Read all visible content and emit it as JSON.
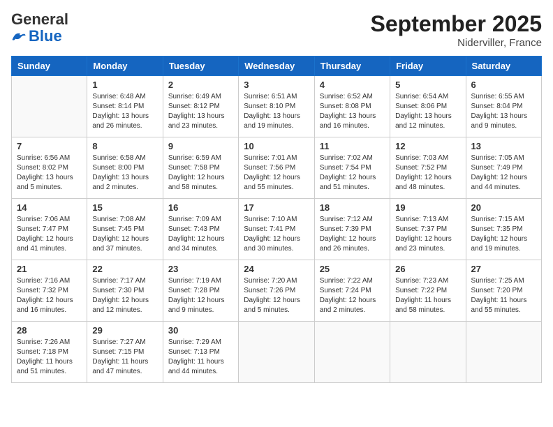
{
  "logo": {
    "general": "General",
    "blue": "Blue"
  },
  "header": {
    "month": "September 2025",
    "location": "Niderviller, France"
  },
  "weekdays": [
    "Sunday",
    "Monday",
    "Tuesday",
    "Wednesday",
    "Thursday",
    "Friday",
    "Saturday"
  ],
  "weeks": [
    [
      {
        "day": "",
        "info": ""
      },
      {
        "day": "1",
        "info": "Sunrise: 6:48 AM\nSunset: 8:14 PM\nDaylight: 13 hours\nand 26 minutes."
      },
      {
        "day": "2",
        "info": "Sunrise: 6:49 AM\nSunset: 8:12 PM\nDaylight: 13 hours\nand 23 minutes."
      },
      {
        "day": "3",
        "info": "Sunrise: 6:51 AM\nSunset: 8:10 PM\nDaylight: 13 hours\nand 19 minutes."
      },
      {
        "day": "4",
        "info": "Sunrise: 6:52 AM\nSunset: 8:08 PM\nDaylight: 13 hours\nand 16 minutes."
      },
      {
        "day": "5",
        "info": "Sunrise: 6:54 AM\nSunset: 8:06 PM\nDaylight: 13 hours\nand 12 minutes."
      },
      {
        "day": "6",
        "info": "Sunrise: 6:55 AM\nSunset: 8:04 PM\nDaylight: 13 hours\nand 9 minutes."
      }
    ],
    [
      {
        "day": "7",
        "info": "Sunrise: 6:56 AM\nSunset: 8:02 PM\nDaylight: 13 hours\nand 5 minutes."
      },
      {
        "day": "8",
        "info": "Sunrise: 6:58 AM\nSunset: 8:00 PM\nDaylight: 13 hours\nand 2 minutes."
      },
      {
        "day": "9",
        "info": "Sunrise: 6:59 AM\nSunset: 7:58 PM\nDaylight: 12 hours\nand 58 minutes."
      },
      {
        "day": "10",
        "info": "Sunrise: 7:01 AM\nSunset: 7:56 PM\nDaylight: 12 hours\nand 55 minutes."
      },
      {
        "day": "11",
        "info": "Sunrise: 7:02 AM\nSunset: 7:54 PM\nDaylight: 12 hours\nand 51 minutes."
      },
      {
        "day": "12",
        "info": "Sunrise: 7:03 AM\nSunset: 7:52 PM\nDaylight: 12 hours\nand 48 minutes."
      },
      {
        "day": "13",
        "info": "Sunrise: 7:05 AM\nSunset: 7:49 PM\nDaylight: 12 hours\nand 44 minutes."
      }
    ],
    [
      {
        "day": "14",
        "info": "Sunrise: 7:06 AM\nSunset: 7:47 PM\nDaylight: 12 hours\nand 41 minutes."
      },
      {
        "day": "15",
        "info": "Sunrise: 7:08 AM\nSunset: 7:45 PM\nDaylight: 12 hours\nand 37 minutes."
      },
      {
        "day": "16",
        "info": "Sunrise: 7:09 AM\nSunset: 7:43 PM\nDaylight: 12 hours\nand 34 minutes."
      },
      {
        "day": "17",
        "info": "Sunrise: 7:10 AM\nSunset: 7:41 PM\nDaylight: 12 hours\nand 30 minutes."
      },
      {
        "day": "18",
        "info": "Sunrise: 7:12 AM\nSunset: 7:39 PM\nDaylight: 12 hours\nand 26 minutes."
      },
      {
        "day": "19",
        "info": "Sunrise: 7:13 AM\nSunset: 7:37 PM\nDaylight: 12 hours\nand 23 minutes."
      },
      {
        "day": "20",
        "info": "Sunrise: 7:15 AM\nSunset: 7:35 PM\nDaylight: 12 hours\nand 19 minutes."
      }
    ],
    [
      {
        "day": "21",
        "info": "Sunrise: 7:16 AM\nSunset: 7:32 PM\nDaylight: 12 hours\nand 16 minutes."
      },
      {
        "day": "22",
        "info": "Sunrise: 7:17 AM\nSunset: 7:30 PM\nDaylight: 12 hours\nand 12 minutes."
      },
      {
        "day": "23",
        "info": "Sunrise: 7:19 AM\nSunset: 7:28 PM\nDaylight: 12 hours\nand 9 minutes."
      },
      {
        "day": "24",
        "info": "Sunrise: 7:20 AM\nSunset: 7:26 PM\nDaylight: 12 hours\nand 5 minutes."
      },
      {
        "day": "25",
        "info": "Sunrise: 7:22 AM\nSunset: 7:24 PM\nDaylight: 12 hours\nand 2 minutes."
      },
      {
        "day": "26",
        "info": "Sunrise: 7:23 AM\nSunset: 7:22 PM\nDaylight: 11 hours\nand 58 minutes."
      },
      {
        "day": "27",
        "info": "Sunrise: 7:25 AM\nSunset: 7:20 PM\nDaylight: 11 hours\nand 55 minutes."
      }
    ],
    [
      {
        "day": "28",
        "info": "Sunrise: 7:26 AM\nSunset: 7:18 PM\nDaylight: 11 hours\nand 51 minutes."
      },
      {
        "day": "29",
        "info": "Sunrise: 7:27 AM\nSunset: 7:15 PM\nDaylight: 11 hours\nand 47 minutes."
      },
      {
        "day": "30",
        "info": "Sunrise: 7:29 AM\nSunset: 7:13 PM\nDaylight: 11 hours\nand 44 minutes."
      },
      {
        "day": "",
        "info": ""
      },
      {
        "day": "",
        "info": ""
      },
      {
        "day": "",
        "info": ""
      },
      {
        "day": "",
        "info": ""
      }
    ]
  ]
}
